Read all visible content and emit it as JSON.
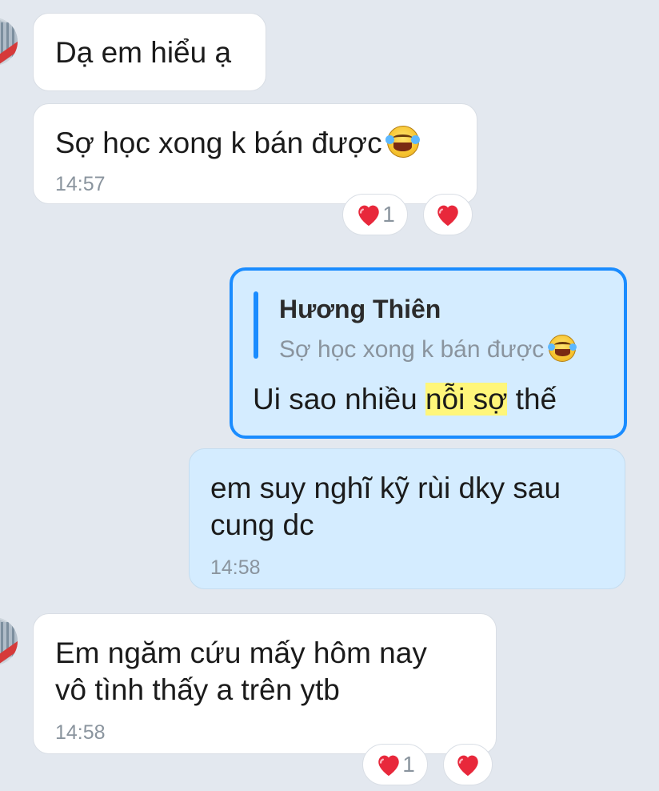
{
  "messages": {
    "m1": {
      "text": "Dạ em hiểu ạ"
    },
    "m2": {
      "text": "Sợ học xong k bán được",
      "time": "14:57",
      "reaction_count": "1"
    },
    "m3": {
      "quote_name": "Hương Thiên",
      "quote_text": "Sợ học xong k bán được",
      "text_before": "Ui sao nhiều ",
      "text_highlight": "nỗi sợ",
      "text_after": " thế"
    },
    "m4": {
      "line1": "em suy nghĩ kỹ rùi dky sau",
      "line2": "cung dc",
      "time": "14:58"
    },
    "m5": {
      "line1": "Em ngăm cứu mấy hôm nay",
      "line2": "vô tình thấy a trên ytb",
      "time": "14:58",
      "reaction_count": "1"
    }
  },
  "icons": {
    "emoji": "face-with-tears-of-joy-icon",
    "heart": "red-heart-icon"
  },
  "colors": {
    "background": "#e3e8ef",
    "incoming_bubble": "#ffffff",
    "outgoing_bubble": "#d4ecff",
    "selected_border": "#1a8cff",
    "highlight": "#fff67a"
  }
}
